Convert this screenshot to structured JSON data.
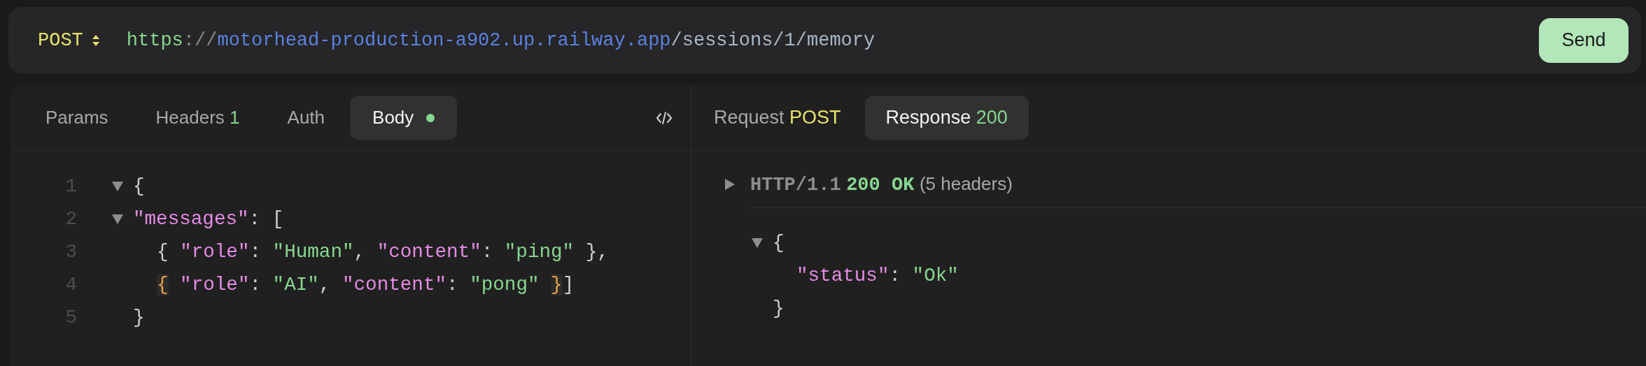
{
  "request_bar": {
    "method": "POST",
    "url_parts": [
      {
        "kind": "scheme",
        "text": "https"
      },
      {
        "kind": "separator",
        "text": "://"
      },
      {
        "kind": "host",
        "text": "motorhead-production-a902.up.railway.app"
      },
      {
        "kind": "path",
        "text": "/sessions/1/memory"
      }
    ],
    "send_label": "Send"
  },
  "request_tabs": [
    {
      "label": "Params",
      "selected": false
    },
    {
      "label": "Headers",
      "badge": "1",
      "selected": false
    },
    {
      "label": "Auth",
      "selected": false
    },
    {
      "label": "Body",
      "selected": true,
      "dot": true
    }
  ],
  "response_tabs": [
    {
      "label": "Request",
      "badge": {
        "text": "POST",
        "kind": "method"
      },
      "selected": false
    },
    {
      "label": "Response",
      "badge": {
        "text": "200",
        "kind": "status"
      },
      "selected": true
    }
  ],
  "body_lines": [
    {
      "number": "1",
      "foldable": true,
      "indented": false,
      "tokens": [
        {
          "kind": "punct",
          "text": "{"
        }
      ]
    },
    {
      "number": "2",
      "foldable": true,
      "indented": false,
      "tokens": [
        {
          "kind": "key",
          "text": "\"messages\""
        },
        {
          "kind": "punct",
          "text": ": ["
        }
      ]
    },
    {
      "number": "3",
      "foldable": false,
      "indented": true,
      "tokens": [
        {
          "kind": "punct",
          "text": "{ "
        },
        {
          "kind": "key",
          "text": "\"role\""
        },
        {
          "kind": "punct",
          "text": ": "
        },
        {
          "kind": "string",
          "text": "\"Human\""
        },
        {
          "kind": "punct",
          "text": ", "
        },
        {
          "kind": "key",
          "text": "\"content\""
        },
        {
          "kind": "punct",
          "text": ": "
        },
        {
          "kind": "string",
          "text": "\"ping\""
        },
        {
          "kind": "punct",
          "text": " },"
        }
      ]
    },
    {
      "number": "4",
      "foldable": false,
      "indented": true,
      "tokens": [
        {
          "kind": "match",
          "text": "{"
        },
        {
          "kind": "key",
          "text": " \"role\""
        },
        {
          "kind": "punct",
          "text": ": "
        },
        {
          "kind": "string",
          "text": "\"AI\""
        },
        {
          "kind": "punct",
          "text": ", "
        },
        {
          "kind": "key",
          "text": "\"content\""
        },
        {
          "kind": "punct",
          "text": ": "
        },
        {
          "kind": "string",
          "text": "\"pong\" "
        },
        {
          "kind": "match",
          "text": "}"
        },
        {
          "kind": "punct",
          "text": "]"
        }
      ]
    },
    {
      "number": "5",
      "foldable": false,
      "indented": false,
      "tokens": [
        {
          "kind": "punct",
          "text": "}"
        }
      ]
    }
  ],
  "response": {
    "protocol": "HTTP/1.1",
    "status": "200 OK",
    "headers_count": "(5 headers)",
    "headers_expanded": false,
    "lines": [
      {
        "foldable": true,
        "indented": false,
        "tokens": [
          {
            "kind": "punct",
            "text": "{"
          }
        ]
      },
      {
        "foldable": false,
        "indented": true,
        "tokens": [
          {
            "kind": "key",
            "text": "\"status\""
          },
          {
            "kind": "punct",
            "text": ": "
          },
          {
            "kind": "string",
            "text": "\"Ok\""
          }
        ]
      },
      {
        "foldable": false,
        "indented": false,
        "tokens": [
          {
            "kind": "punct",
            "text": "}"
          }
        ]
      }
    ]
  }
}
